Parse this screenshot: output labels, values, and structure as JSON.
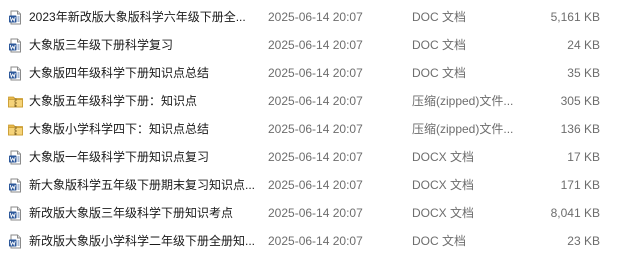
{
  "colors": {
    "doc_icon": "#2b579a",
    "zip_icon": "#e8b84a",
    "meta_text": "#6d6d6d",
    "name_text": "#1a1a1a"
  },
  "files": [
    {
      "icon": "word-doc-icon",
      "name": "2023年新改版大象版科学六年级下册全...",
      "date": "2025-06-14 20:07",
      "type": "DOC 文档",
      "size": "5,161 KB"
    },
    {
      "icon": "word-doc-icon",
      "name": "大象版三年级下册科学复习",
      "date": "2025-06-14 20:07",
      "type": "DOC 文档",
      "size": "24 KB"
    },
    {
      "icon": "word-doc-icon",
      "name": "大象版四年级科学下册知识点总结",
      "date": "2025-06-14 20:07",
      "type": "DOC 文档",
      "size": "35 KB"
    },
    {
      "icon": "zip-folder-icon",
      "name": "大象版五年级科学下册：知识点",
      "date": "2025-06-14 20:07",
      "type": "压缩(zipped)文件...",
      "size": "305 KB"
    },
    {
      "icon": "zip-folder-icon",
      "name": "大象版小学科学四下：知识点总结",
      "date": "2025-06-14 20:07",
      "type": "压缩(zipped)文件...",
      "size": "136 KB"
    },
    {
      "icon": "word-doc-icon",
      "name": "大象版一年级科学下册知识点复习",
      "date": "2025-06-14 20:07",
      "type": "DOCX 文档",
      "size": "17 KB"
    },
    {
      "icon": "word-doc-icon",
      "name": "新大象版科学五年级下册期末复习知识点...",
      "date": "2025-06-14 20:07",
      "type": "DOCX 文档",
      "size": "171 KB"
    },
    {
      "icon": "word-doc-icon",
      "name": "新改版大象版三年级科学下册知识考点",
      "date": "2025-06-14 20:07",
      "type": "DOCX 文档",
      "size": "8,041 KB"
    },
    {
      "icon": "word-doc-icon",
      "name": "新改版大象版小学科学二年级下册全册知...",
      "date": "2025-06-14 20:07",
      "type": "DOC 文档",
      "size": "23 KB"
    }
  ]
}
